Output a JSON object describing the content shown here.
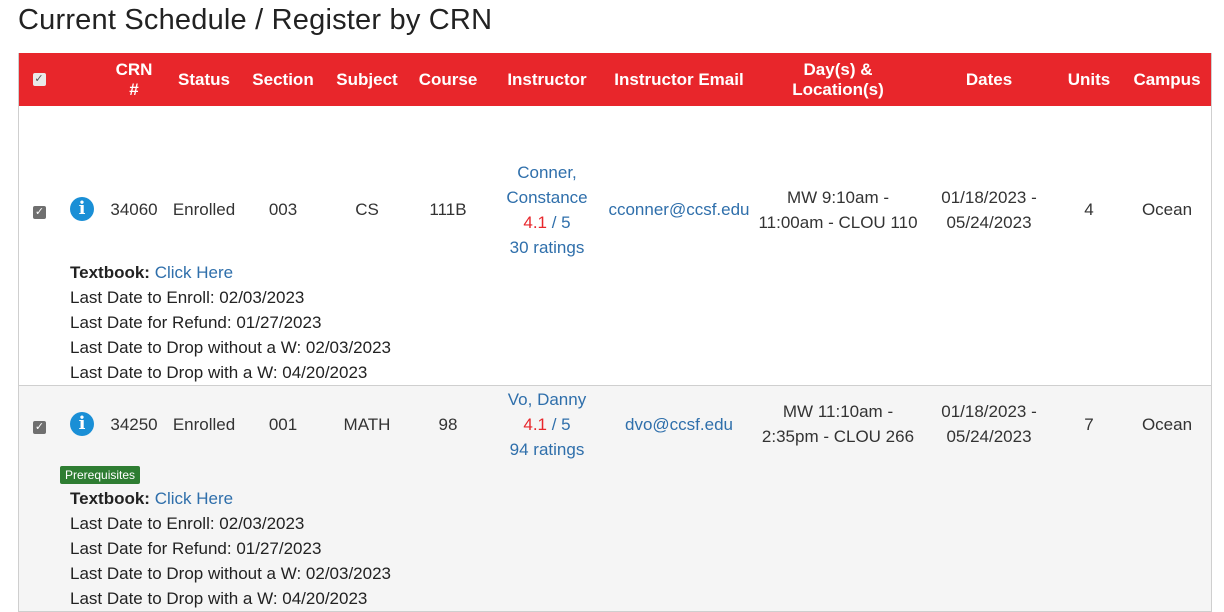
{
  "page": {
    "title": "Current Schedule / Register by CRN"
  },
  "table": {
    "header": {
      "select_all_check": "✓",
      "crn_line1": "CRN",
      "crn_line2": "#",
      "status": "Status",
      "section": "Section",
      "subject": "Subject",
      "course": "Course",
      "instructor": "Instructor",
      "instructor_email": "Instructor Email",
      "days_line1": "Day(s) &",
      "days_line2": "Location(s)",
      "dates": "Dates",
      "units": "Units",
      "campus": "Campus"
    },
    "rows": [
      {
        "checked": "✓",
        "info_icon": "i",
        "crn": "34060",
        "status": "Enrolled",
        "section": "003",
        "subject": "CS",
        "course": "111B",
        "instructor_line1": "Conner,",
        "instructor_line2": "Constance",
        "rating": "4.1",
        "rating_suffix": " / 5",
        "ratings_count": "30 ratings",
        "email": "cconner@ccsf.edu",
        "schedule_line1": "MW 9:10am -",
        "schedule_line2": "11:00am - CLOU 110",
        "dates_line1": "01/18/2023 -",
        "dates_line2": "05/24/2023",
        "units": "4",
        "campus": "Ocean",
        "textbook_label": "Textbook:",
        "textbook_link": "Click Here",
        "last_enroll": "Last Date to Enroll: 02/03/2023",
        "last_refund": "Last Date for Refund: 01/27/2023",
        "last_drop_no_w": "Last Date to Drop without a W: 02/03/2023",
        "last_drop_w": "Last Date to Drop with a W: 04/20/2023"
      },
      {
        "checked": "✓",
        "info_icon": "i",
        "crn": "34250",
        "status": "Enrolled",
        "section": "001",
        "subject": "MATH",
        "course": "98",
        "instructor_line1": "Vo, Danny",
        "rating": "4.1",
        "rating_suffix": " / 5",
        "ratings_count": "94 ratings",
        "email": "dvo@ccsf.edu",
        "schedule_line1": "MW 11:10am -",
        "schedule_line2": "2:35pm - CLOU 266",
        "dates_line1": "01/18/2023 -",
        "dates_line2": "05/24/2023",
        "units": "7",
        "campus": "Ocean",
        "badge": "Prerequisites",
        "textbook_label": "Textbook:",
        "textbook_link": "Click Here",
        "last_enroll": "Last Date to Enroll: 02/03/2023",
        "last_refund": "Last Date for Refund: 01/27/2023",
        "last_drop_no_w": "Last Date to Drop without a W: 02/03/2023",
        "last_drop_w": "Last Date to Drop with a W: 04/20/2023"
      }
    ]
  },
  "colors": {
    "header_bg": "#e8262b",
    "link": "#2f6fab",
    "rating": "#e8262b",
    "info_icon": "#1a8fd6",
    "badge_bg": "#2e7d32"
  }
}
